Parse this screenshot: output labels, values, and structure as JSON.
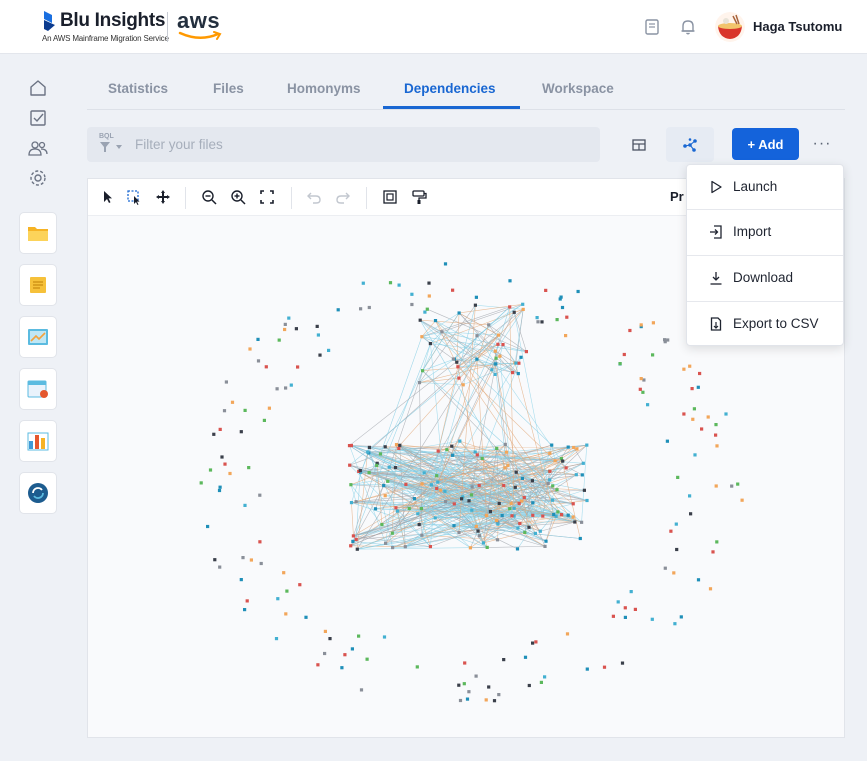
{
  "header": {
    "brand": "Blu Insights",
    "brand_sub": "An AWS Mainframe Migration Service",
    "aws": "aws",
    "username": "Haga Tsutomu",
    "icons": [
      "book-icon",
      "bell-icon"
    ]
  },
  "rail": {
    "icons": [
      "home-icon",
      "checklist-icon",
      "users-icon",
      "settings-icon"
    ],
    "apps": [
      "folder-app",
      "notes-app",
      "dashboard-app",
      "calendar-app",
      "charts-app",
      "sync-app"
    ]
  },
  "tabs": [
    {
      "label": "Statistics",
      "active": false
    },
    {
      "label": "Files",
      "active": false
    },
    {
      "label": "Homonyms",
      "active": false
    },
    {
      "label": "Dependencies",
      "active": true
    },
    {
      "label": "Workspace",
      "active": false
    }
  ],
  "filter": {
    "tag": "BQL",
    "placeholder": "Filter your files"
  },
  "actions": {
    "add_label": "+ Add",
    "more_label": "···"
  },
  "panel": {
    "label": "Pr"
  },
  "menu": {
    "items": [
      {
        "label": "Launch",
        "icon": "play-icon"
      },
      {
        "label": "Import",
        "icon": "import-icon"
      },
      {
        "label": "Download",
        "icon": "download-icon"
      },
      {
        "label": "Export to CSV",
        "icon": "export-csv-icon"
      }
    ]
  },
  "colors": {
    "accent": "#1463db",
    "node_palette": [
      "#43b0d1",
      "#f2a65a",
      "#5cb85c",
      "#3a3f4a",
      "#d9534f",
      "#1f8fb8",
      "#8a8f99"
    ]
  }
}
